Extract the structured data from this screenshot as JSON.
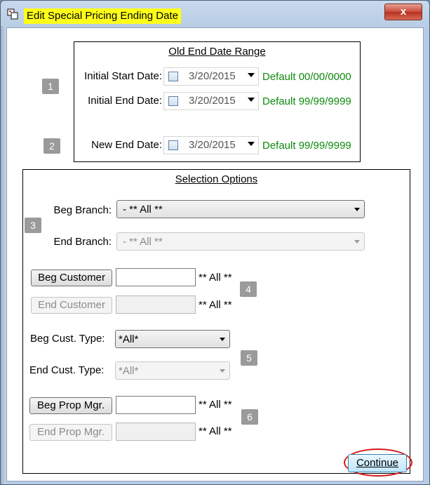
{
  "window": {
    "title": "Edit Special Pricing Ending Date",
    "close_label": "x"
  },
  "old_range": {
    "title": "Old End Date Range",
    "marker": "1",
    "start_label": "Initial Start Date:",
    "start_value": "3/20/2015",
    "start_default": "Default 00/00/0000",
    "end_label": "Initial End Date:",
    "end_value": "3/20/2015",
    "end_default": "Default 99/99/9999"
  },
  "new_end": {
    "marker": "2",
    "label": "New End Date:",
    "value": "3/20/2015",
    "default": "Default 99/99/9999"
  },
  "selection": {
    "title": "Selection Options",
    "branch": {
      "marker": "3",
      "beg_label": "Beg Branch:",
      "beg_value": "- ** All **",
      "end_label": "End Branch:",
      "end_value": "- ** All **"
    },
    "customer": {
      "marker": "4",
      "beg_button": "Beg Customer",
      "beg_value": "",
      "beg_all": "** All **",
      "end_button": "End Customer",
      "end_value": "",
      "end_all": "** All **"
    },
    "cust_type": {
      "marker": "5",
      "beg_label": "Beg Cust. Type:",
      "beg_value": "*All*",
      "end_label": "End Cust. Type:",
      "end_value": "*All*"
    },
    "prop_mgr": {
      "marker": "6",
      "beg_button": "Beg Prop Mgr.",
      "beg_value": "",
      "beg_all": "** All **",
      "end_button": "End Prop Mgr.",
      "end_value": "",
      "end_all": "** All **"
    }
  },
  "footer": {
    "continue_label": "Continue"
  },
  "colors": {
    "default_text": "#0e8a0e",
    "title_highlight": "#ffff1a",
    "annotation_ring": "#d61a1a"
  }
}
